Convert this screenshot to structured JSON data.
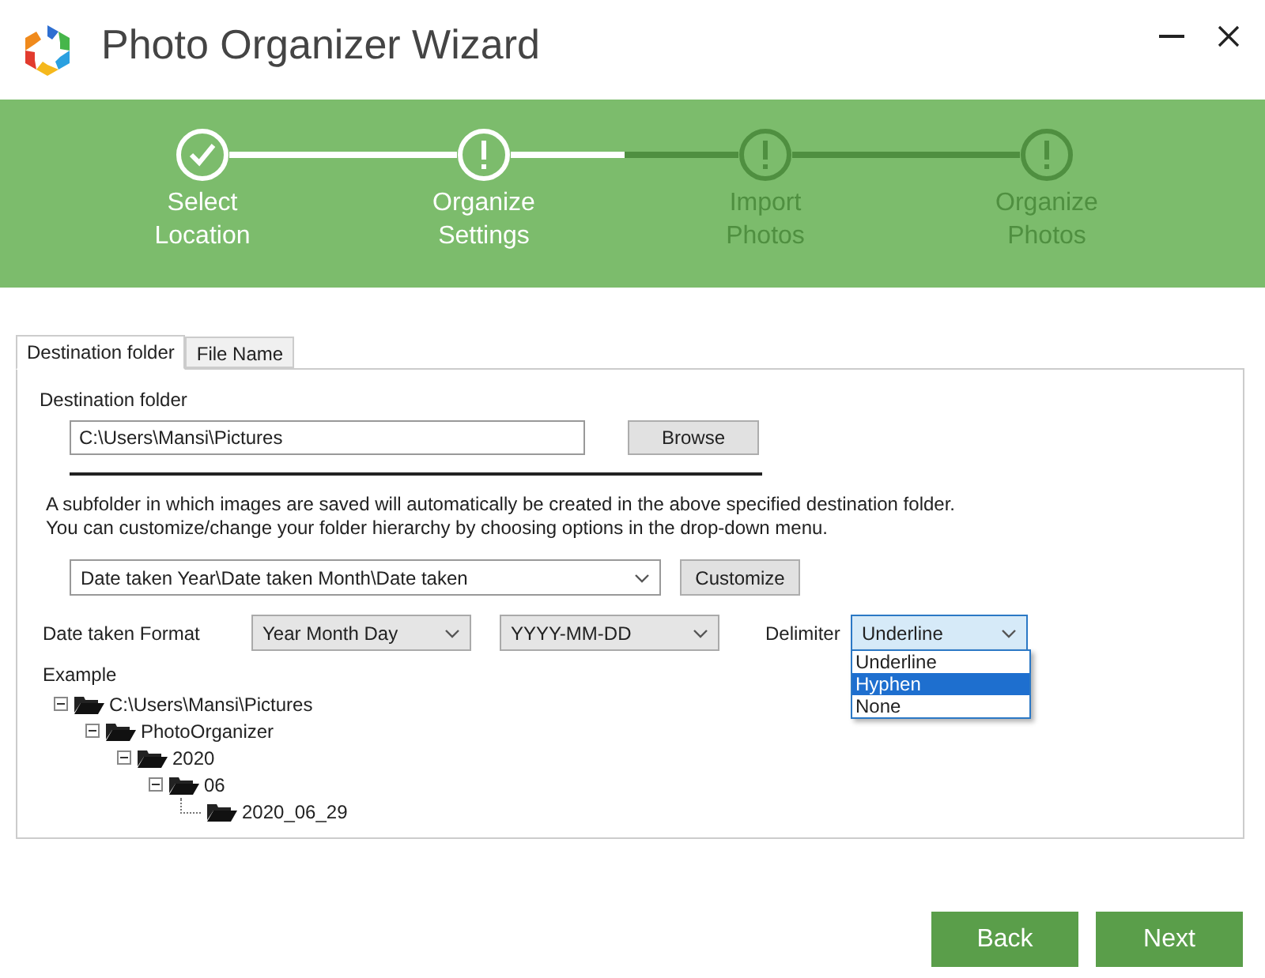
{
  "window": {
    "title": "Photo Organizer Wizard"
  },
  "steps": [
    {
      "label": "Select Location",
      "done": true,
      "active": true
    },
    {
      "label": "Organize Settings",
      "done": false,
      "active": true
    },
    {
      "label": "Import Photos",
      "done": false,
      "active": false
    },
    {
      "label": "Organize Photos",
      "done": false,
      "active": false
    }
  ],
  "tabs": [
    {
      "label": "Destination folder",
      "selected": true
    },
    {
      "label": "File Name",
      "selected": false
    }
  ],
  "destination": {
    "label": "Destination folder",
    "value": "C:\\Users\\Mansi\\Pictures",
    "button": "Browse"
  },
  "info": [
    "A subfolder in which images are saved will automatically be created in the above specified destination folder.",
    "You can customize/change your folder hierarchy by choosing options in the drop-down menu."
  ],
  "hierarchy": {
    "value": "Date taken Year\\Date taken Month\\Date taken",
    "button": "Customize"
  },
  "format": {
    "label": "Date taken Format",
    "order": "Year Month Day",
    "pattern": "YYYY-MM-DD"
  },
  "delimiter": {
    "label": "Delimiter",
    "value": "Underline",
    "expanded": true,
    "options": [
      {
        "label": "Underline",
        "highlighted": false
      },
      {
        "label": "Hyphen",
        "highlighted": true
      },
      {
        "label": "None",
        "highlighted": false
      }
    ]
  },
  "example": {
    "label": "Example",
    "tree": [
      {
        "label": "C:\\Users\\Mansi\\Pictures",
        "children": [
          {
            "label": "PhotoOrganizer",
            "children": [
              {
                "label": "2020",
                "children": [
                  {
                    "label": "06",
                    "children": [
                      {
                        "label": "2020_06_29"
                      }
                    ]
                  }
                ]
              }
            ]
          }
        ]
      }
    ]
  },
  "buttons": [
    "Back",
    "Next"
  ]
}
